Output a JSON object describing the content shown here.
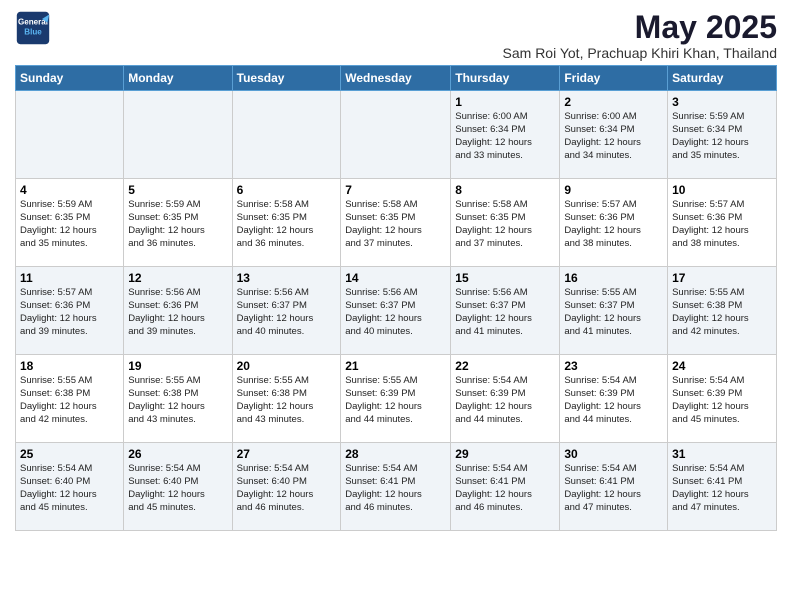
{
  "logo": {
    "line1": "General",
    "line2": "Blue"
  },
  "title": "May 2025",
  "location": "Sam Roi Yot, Prachuap Khiri Khan, Thailand",
  "headers": [
    "Sunday",
    "Monday",
    "Tuesday",
    "Wednesday",
    "Thursday",
    "Friday",
    "Saturday"
  ],
  "weeks": [
    [
      {
        "day": "",
        "info": ""
      },
      {
        "day": "",
        "info": ""
      },
      {
        "day": "",
        "info": ""
      },
      {
        "day": "",
        "info": ""
      },
      {
        "day": "1",
        "info": "Sunrise: 6:00 AM\nSunset: 6:34 PM\nDaylight: 12 hours\nand 33 minutes."
      },
      {
        "day": "2",
        "info": "Sunrise: 6:00 AM\nSunset: 6:34 PM\nDaylight: 12 hours\nand 34 minutes."
      },
      {
        "day": "3",
        "info": "Sunrise: 5:59 AM\nSunset: 6:34 PM\nDaylight: 12 hours\nand 35 minutes."
      }
    ],
    [
      {
        "day": "4",
        "info": "Sunrise: 5:59 AM\nSunset: 6:35 PM\nDaylight: 12 hours\nand 35 minutes."
      },
      {
        "day": "5",
        "info": "Sunrise: 5:59 AM\nSunset: 6:35 PM\nDaylight: 12 hours\nand 36 minutes."
      },
      {
        "day": "6",
        "info": "Sunrise: 5:58 AM\nSunset: 6:35 PM\nDaylight: 12 hours\nand 36 minutes."
      },
      {
        "day": "7",
        "info": "Sunrise: 5:58 AM\nSunset: 6:35 PM\nDaylight: 12 hours\nand 37 minutes."
      },
      {
        "day": "8",
        "info": "Sunrise: 5:58 AM\nSunset: 6:35 PM\nDaylight: 12 hours\nand 37 minutes."
      },
      {
        "day": "9",
        "info": "Sunrise: 5:57 AM\nSunset: 6:36 PM\nDaylight: 12 hours\nand 38 minutes."
      },
      {
        "day": "10",
        "info": "Sunrise: 5:57 AM\nSunset: 6:36 PM\nDaylight: 12 hours\nand 38 minutes."
      }
    ],
    [
      {
        "day": "11",
        "info": "Sunrise: 5:57 AM\nSunset: 6:36 PM\nDaylight: 12 hours\nand 39 minutes."
      },
      {
        "day": "12",
        "info": "Sunrise: 5:56 AM\nSunset: 6:36 PM\nDaylight: 12 hours\nand 39 minutes."
      },
      {
        "day": "13",
        "info": "Sunrise: 5:56 AM\nSunset: 6:37 PM\nDaylight: 12 hours\nand 40 minutes."
      },
      {
        "day": "14",
        "info": "Sunrise: 5:56 AM\nSunset: 6:37 PM\nDaylight: 12 hours\nand 40 minutes."
      },
      {
        "day": "15",
        "info": "Sunrise: 5:56 AM\nSunset: 6:37 PM\nDaylight: 12 hours\nand 41 minutes."
      },
      {
        "day": "16",
        "info": "Sunrise: 5:55 AM\nSunset: 6:37 PM\nDaylight: 12 hours\nand 41 minutes."
      },
      {
        "day": "17",
        "info": "Sunrise: 5:55 AM\nSunset: 6:38 PM\nDaylight: 12 hours\nand 42 minutes."
      }
    ],
    [
      {
        "day": "18",
        "info": "Sunrise: 5:55 AM\nSunset: 6:38 PM\nDaylight: 12 hours\nand 42 minutes."
      },
      {
        "day": "19",
        "info": "Sunrise: 5:55 AM\nSunset: 6:38 PM\nDaylight: 12 hours\nand 43 minutes."
      },
      {
        "day": "20",
        "info": "Sunrise: 5:55 AM\nSunset: 6:38 PM\nDaylight: 12 hours\nand 43 minutes."
      },
      {
        "day": "21",
        "info": "Sunrise: 5:55 AM\nSunset: 6:39 PM\nDaylight: 12 hours\nand 44 minutes."
      },
      {
        "day": "22",
        "info": "Sunrise: 5:54 AM\nSunset: 6:39 PM\nDaylight: 12 hours\nand 44 minutes."
      },
      {
        "day": "23",
        "info": "Sunrise: 5:54 AM\nSunset: 6:39 PM\nDaylight: 12 hours\nand 44 minutes."
      },
      {
        "day": "24",
        "info": "Sunrise: 5:54 AM\nSunset: 6:39 PM\nDaylight: 12 hours\nand 45 minutes."
      }
    ],
    [
      {
        "day": "25",
        "info": "Sunrise: 5:54 AM\nSunset: 6:40 PM\nDaylight: 12 hours\nand 45 minutes."
      },
      {
        "day": "26",
        "info": "Sunrise: 5:54 AM\nSunset: 6:40 PM\nDaylight: 12 hours\nand 45 minutes."
      },
      {
        "day": "27",
        "info": "Sunrise: 5:54 AM\nSunset: 6:40 PM\nDaylight: 12 hours\nand 46 minutes."
      },
      {
        "day": "28",
        "info": "Sunrise: 5:54 AM\nSunset: 6:41 PM\nDaylight: 12 hours\nand 46 minutes."
      },
      {
        "day": "29",
        "info": "Sunrise: 5:54 AM\nSunset: 6:41 PM\nDaylight: 12 hours\nand 46 minutes."
      },
      {
        "day": "30",
        "info": "Sunrise: 5:54 AM\nSunset: 6:41 PM\nDaylight: 12 hours\nand 47 minutes."
      },
      {
        "day": "31",
        "info": "Sunrise: 5:54 AM\nSunset: 6:41 PM\nDaylight: 12 hours\nand 47 minutes."
      }
    ]
  ]
}
